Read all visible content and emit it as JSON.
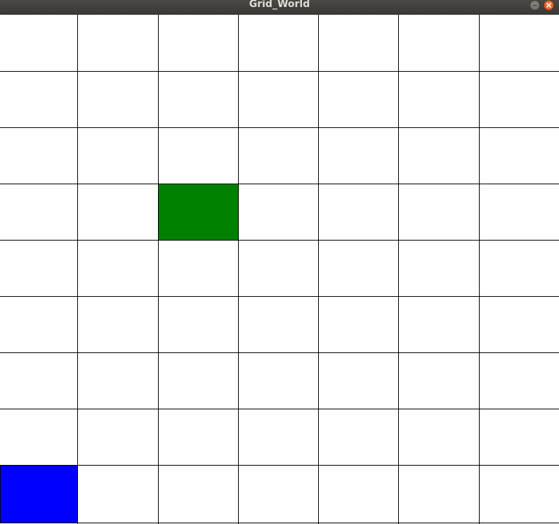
{
  "window": {
    "title": "Grid_World",
    "buttons": [
      "minimize",
      "close"
    ],
    "close_color": "#e95420"
  },
  "grid": {
    "columns": 7,
    "rows": 9,
    "line_color": "#000000",
    "background_color": "#ffffff",
    "cells": [
      {
        "role": "goal",
        "column": 3,
        "row": 4,
        "color": "#008000"
      },
      {
        "role": "agent",
        "column": 1,
        "row": 9,
        "color": "#0000ff"
      }
    ]
  }
}
